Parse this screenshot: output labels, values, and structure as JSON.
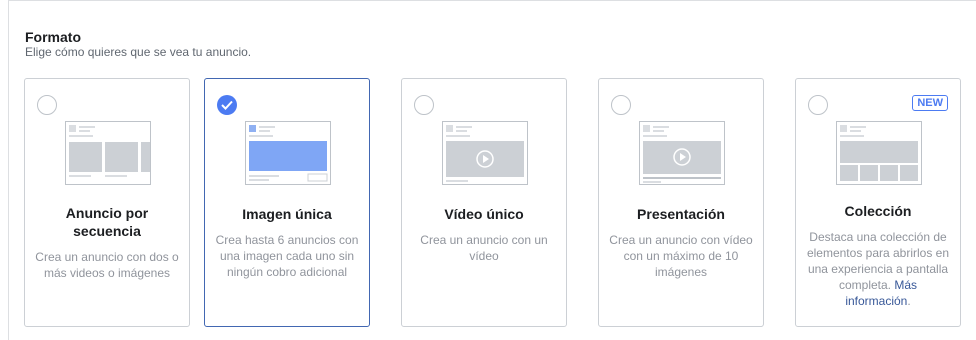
{
  "section": {
    "title": "Formato",
    "subtitle": "Elige cómo quieres que se vea tu anuncio."
  },
  "colors": {
    "accent": "#4c7bf2",
    "selected_border": "#4267b2",
    "link": "#385898"
  },
  "cards": [
    {
      "name": "Anuncio por secuencia",
      "description": "Crea un anuncio con dos o más videos o imágenes",
      "selected": false
    },
    {
      "name": "Imagen única",
      "description": "Crea hasta 6 anuncios con una imagen cada uno sin ningún cobro adicional",
      "selected": true
    },
    {
      "name": "Vídeo único",
      "description": "Crea un anuncio con un vídeo",
      "selected": false
    },
    {
      "name": "Presentación",
      "description": "Crea un anuncio con vídeo con un máximo de 10 imágenes",
      "selected": false
    },
    {
      "name": "Colección",
      "description": "Destaca una colección de elementos para abrirlos en una experiencia a pantalla completa.",
      "link_text": "Más información",
      "badge": "NEW",
      "selected": false
    }
  ]
}
